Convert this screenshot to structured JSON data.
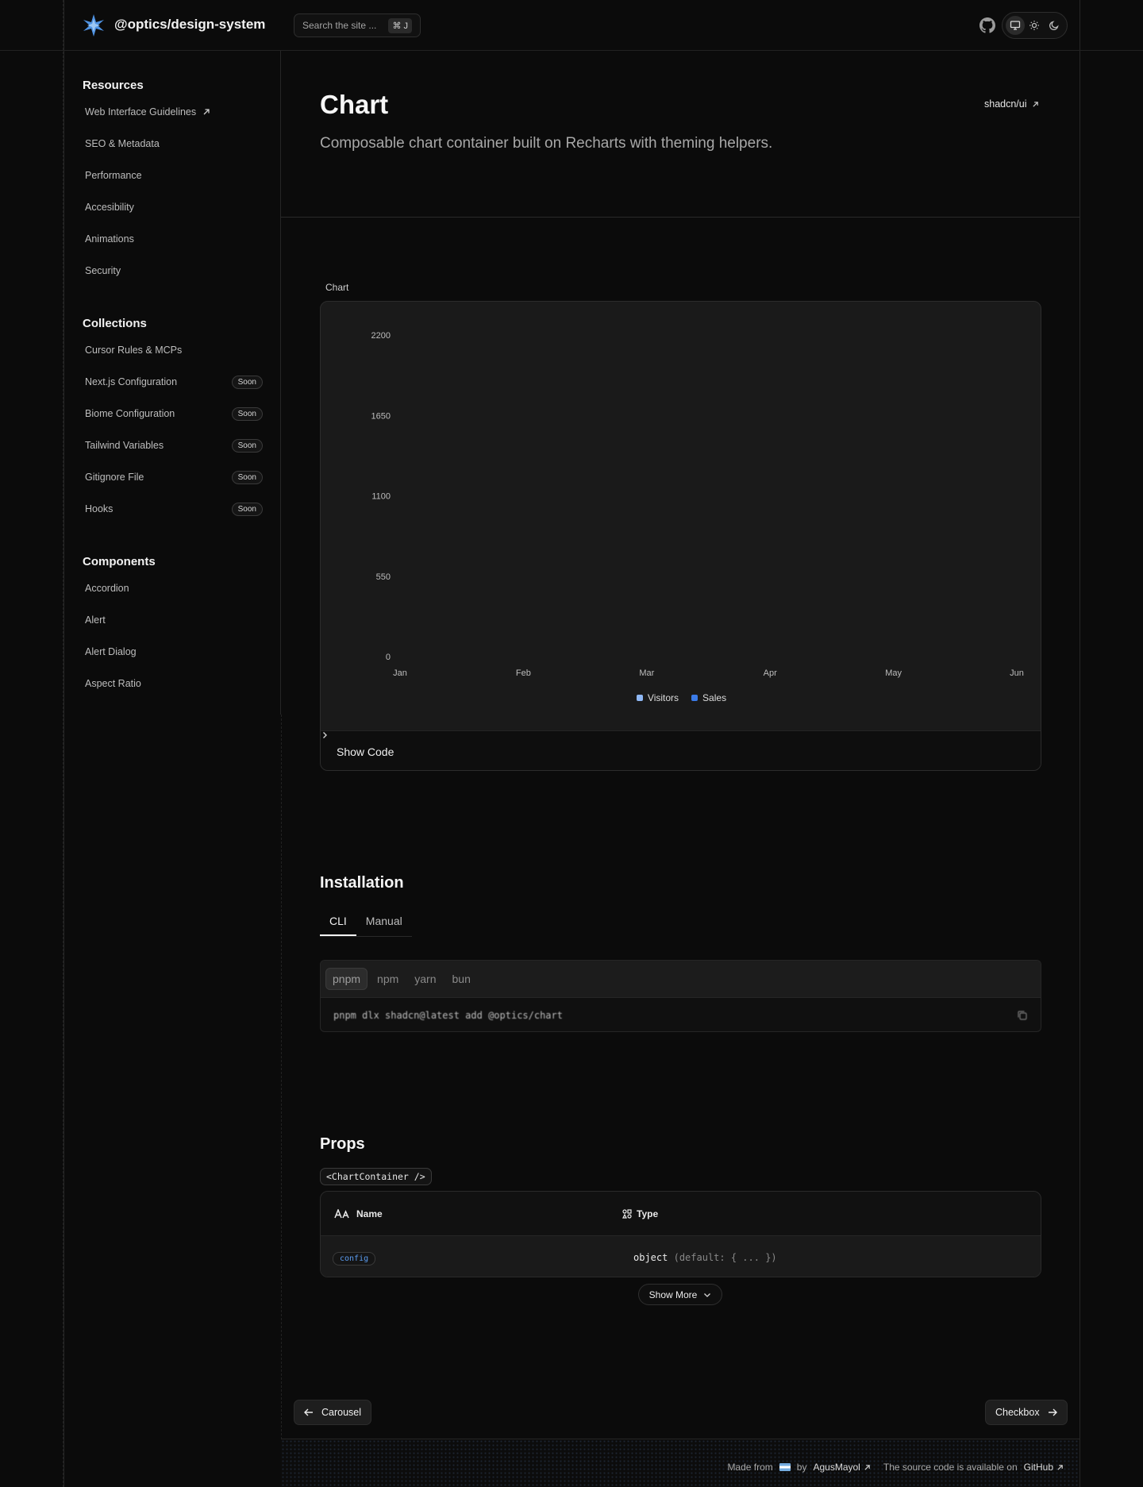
{
  "header": {
    "brand": "@optics/design-system",
    "search_placeholder": "Search the site ...",
    "search_shortcut": "⌘ J"
  },
  "sidebar": {
    "sections": [
      {
        "title": "Resources",
        "items": [
          {
            "label": "Web Interface Guidelines",
            "external": true
          },
          {
            "label": "SEO & Metadata"
          },
          {
            "label": "Performance"
          },
          {
            "label": "Accesibility"
          },
          {
            "label": "Animations"
          },
          {
            "label": "Security"
          }
        ]
      },
      {
        "title": "Collections",
        "items": [
          {
            "label": "Cursor Rules & MCPs"
          },
          {
            "label": "Next.js Configuration",
            "badge": "Soon"
          },
          {
            "label": "Biome Configuration",
            "badge": "Soon"
          },
          {
            "label": "Tailwind Variables",
            "badge": "Soon"
          },
          {
            "label": "Gitignore File",
            "badge": "Soon"
          },
          {
            "label": "Hooks",
            "badge": "Soon"
          }
        ]
      },
      {
        "title": "Components",
        "items": [
          {
            "label": "Accordion"
          },
          {
            "label": "Alert"
          },
          {
            "label": "Alert Dialog"
          },
          {
            "label": "Aspect Ratio"
          }
        ]
      }
    ]
  },
  "page": {
    "title": "Chart",
    "description": "Composable chart container built on Recharts with theming helpers.",
    "external_link": "shadcn/ui"
  },
  "demo": {
    "label": "Chart",
    "show_code": "Show Code"
  },
  "chart_data": {
    "type": "bar",
    "categories": [
      "Jan",
      "Feb",
      "Mar",
      "Apr",
      "May",
      "Jun"
    ],
    "series": [
      {
        "name": "Visitors",
        "values": [
          0,
          0,
          0,
          0,
          0,
          0
        ],
        "color": "#8fb8f5"
      },
      {
        "name": "Sales",
        "values": [
          0,
          0,
          0,
          0,
          0,
          0
        ],
        "color": "#3b7be8"
      }
    ],
    "yticks": [
      0,
      550,
      1100,
      1650,
      2200
    ],
    "ylim": [
      0,
      2200
    ],
    "legend": "bottom-center",
    "grid": false
  },
  "installation": {
    "title": "Installation",
    "tabs": [
      "CLI",
      "Manual"
    ],
    "active_tab": "CLI",
    "package_managers": [
      "pnpm",
      "npm",
      "yarn",
      "bun"
    ],
    "active_pm": "pnpm",
    "command": "pnpm dlx shadcn@latest add @optics/chart"
  },
  "props": {
    "title": "Props",
    "component": "<ChartContainer />",
    "columns": [
      "Name",
      "Type"
    ],
    "rows": [
      {
        "name": "config",
        "type": "object",
        "default": "(default: { ... })"
      }
    ],
    "show_more": "Show More"
  },
  "pager": {
    "prev": "Carousel",
    "next": "Checkbox"
  },
  "footer": {
    "made_from": "Made from",
    "by": "by",
    "author": "AgusMayol",
    "source_text": "The source code is available on",
    "source_link": "GitHub"
  }
}
